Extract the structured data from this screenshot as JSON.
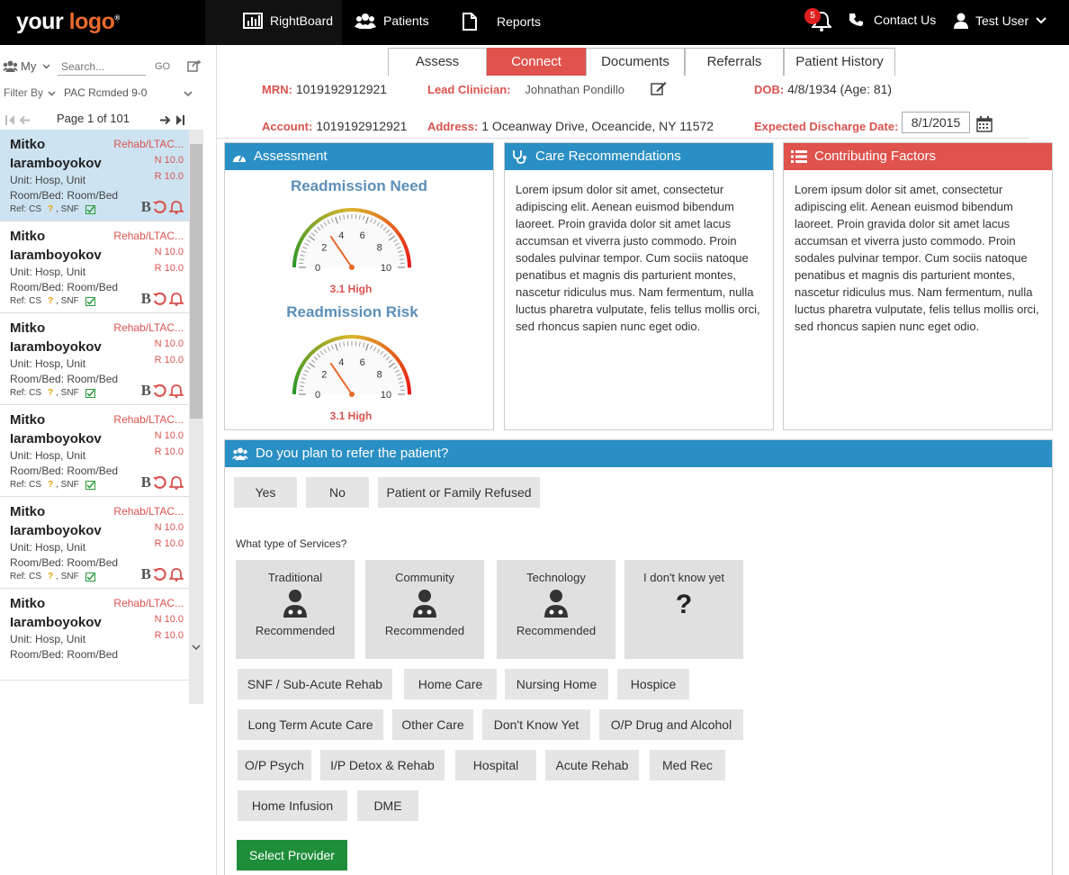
{
  "header": {
    "logo_your": "your",
    "logo_logo": "logo",
    "nav": [
      "RightBoard",
      "Patients",
      "Reports"
    ],
    "notifications": "5",
    "contact": "Contact Us",
    "user": "Test User"
  },
  "sidebar": {
    "my": "My",
    "search_placeholder": "Search...",
    "go": "GO",
    "filter_by": "Filter By",
    "filter_value": "PAC Rcmded 9-0",
    "page": "Page 1 of 101",
    "patients": [
      {
        "first": "Mitko",
        "last": "Iaramboyokov",
        "type": "Rehab/LTAC...",
        "n": "N 10.0",
        "r": "R 10.0",
        "unit": "Unit: Hosp, Unit",
        "room": "Room/Bed: Room/Bed",
        "ref": "Ref: CS",
        "snf": ", SNF"
      },
      {
        "first": "Mitko",
        "last": "Iaramboyokov",
        "type": "Rehab/LTAC...",
        "n": "N 10.0",
        "r": "R 10.0",
        "unit": "Unit: Hosp, Unit",
        "room": "Room/Bed: Room/Bed",
        "ref": "Ref: CS",
        "snf": ", SNF"
      },
      {
        "first": "Mitko",
        "last": "Iaramboyokov",
        "type": "Rehab/LTAC...",
        "n": "N 10.0",
        "r": "R 10.0",
        "unit": "Unit: Hosp, Unit",
        "room": "Room/Bed: Room/Bed",
        "ref": "Ref: CS",
        "snf": ", SNF"
      },
      {
        "first": "Mitko",
        "last": "Iaramboyokov",
        "type": "Rehab/LTAC...",
        "n": "N 10.0",
        "r": "R 10.0",
        "unit": "Unit: Hosp, Unit",
        "room": "Room/Bed: Room/Bed",
        "ref": "Ref: CS",
        "snf": ", SNF"
      },
      {
        "first": "Mitko",
        "last": "Iaramboyokov",
        "type": "Rehab/LTAC...",
        "n": "N 10.0",
        "r": "R 10.0",
        "unit": "Unit: Hosp, Unit",
        "room": "Room/Bed: Room/Bed",
        "ref": "Ref: CS",
        "snf": ", SNF"
      },
      {
        "first": "Mitko",
        "last": "Iaramboyokov",
        "type": "Rehab/LTAC...",
        "n": "N 10.0",
        "r": "R 10.0",
        "unit": "Unit: Hosp, Unit",
        "room": "Room/Bed: Room/Bed",
        "ref": "",
        "snf": ""
      }
    ]
  },
  "tabs": [
    "Assess",
    "Connect",
    "Documents",
    "Referrals",
    "Patient History"
  ],
  "info": {
    "mrn_label": "MRN:",
    "mrn": "1019192912921",
    "lead_label": "Lead Clinician:",
    "lead": "Johnathan Pondillo",
    "dob_label": "DOB:",
    "dob": "4/8/1934 (Age: 81)",
    "account_label": "Account:",
    "account": "1019192912921",
    "address_label": "Address:",
    "address": "1 Oceanway Drive, Oceancide, NY 11572",
    "discharge_label": "Expected Discharge Date:",
    "discharge": "8/1/2015"
  },
  "assessment": {
    "title": "Assessment",
    "need_title": "Readmission Need",
    "need_value": "3.1 High",
    "need_score": 3.1,
    "risk_title": "Readmission Risk",
    "risk_value": "3.1 High",
    "risk_score": 3.1,
    "ticks": [
      "0",
      "2",
      "4",
      "6",
      "8",
      "10"
    ]
  },
  "care": {
    "title": "Care Recommendations",
    "text": "Lorem ipsum dolor sit amet, consectetur adipiscing elit. Aenean euismod bibendum laoreet. Proin gravida dolor sit amet lacus accumsan et viverra justo commodo. Proin sodales pulvinar tempor. Cum sociis natoque penatibus et magnis dis parturient montes, nascetur ridiculus mus. Nam fermentum, nulla luctus pharetra vulputate, felis tellus mollis orci, sed rhoncus sapien nunc eget odio."
  },
  "factors": {
    "title": "Contributing Factors",
    "text": "Lorem ipsum dolor sit amet, consectetur adipiscing elit. Aenean euismod bibendum laoreet. Proin gravida dolor sit amet lacus accumsan et viverra justo commodo. Proin sodales pulvinar tempor. Cum sociis natoque penatibus et magnis dis parturient montes, nascetur ridiculus mus. Nam fermentum, nulla luctus pharetra vulputate, felis tellus mollis orci, sed rhoncus sapien nunc eget odio."
  },
  "refer": {
    "title": "Do you plan to refer the patient?",
    "yes": "Yes",
    "no": "No",
    "refused": "Patient or Family Refused",
    "services_q": "What type of Services?",
    "service_types": [
      {
        "name": "Traditional",
        "sub": "Recommended"
      },
      {
        "name": "Community",
        "sub": "Recommended"
      },
      {
        "name": "Technology",
        "sub": "Recommended"
      },
      {
        "name": "I don't know yet",
        "sub": ""
      }
    ],
    "options": [
      "SNF / Sub-Acute Rehab",
      "Home Care",
      "Nursing Home",
      "Hospice",
      "Long Term Acute Care",
      "Other Care",
      "Don't Know Yet",
      "O/P Drug and Alcohol",
      "O/P Psych",
      "I/P Detox & Rehab",
      "Hospital",
      "Acute Rehab",
      "Med Rec",
      "Home Infusion",
      "DME"
    ],
    "select_provider": "Select Provider"
  },
  "colors": {
    "accent_blue": "#2a8fc4",
    "accent_red": "#e0524c",
    "green": "#1f8e3a"
  }
}
